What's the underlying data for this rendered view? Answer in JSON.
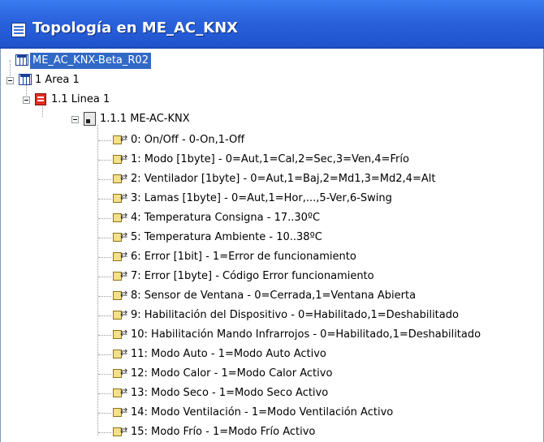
{
  "window": {
    "title": "Topología en ME_AC_KNX"
  },
  "tree": {
    "root": "ME_AC_KNX-Beta_R02",
    "area": "1 Area 1",
    "line": "1.1 Linea 1",
    "device": "1.1.1 ME-AC-KNX",
    "objects": [
      "0: On/Off - 0-On,1-Off",
      "1: Modo [1byte] - 0=Aut,1=Cal,2=Sec,3=Ven,4=Frío",
      "2: Ventilador [1byte] - 0=Aut,1=Baj,2=Md1,3=Md2,4=Alt",
      "3: Lamas [1byte] - 0=Aut,1=Hor,...,5-Ver,6-Swing",
      "4: Temperatura Consigna - 17..30ºC",
      "5: Temperatura Ambiente - 10..38ºC",
      "6: Error [1bit] - 1=Error de funcionamiento",
      "7: Error [1byte] - Código Error funcionamiento",
      "8: Sensor de Ventana - 0=Cerrada,1=Ventana Abierta",
      "9: Habilitación del Dispositivo - 0=Habilitado,1=Deshabilitado",
      "10: Habilitación Mando Infrarrojos - 0=Habilitado,1=Deshabilitado",
      "11: Modo Auto - 1=Modo Auto Activo",
      "12: Modo Calor - 1=Modo Calor Activo",
      "13: Modo Seco - 1=Modo Seco Activo",
      "14: Modo Ventilación - 1=Modo Ventilación Activo",
      "15: Modo Frío - 1=Modo Frío Activo"
    ]
  },
  "colors": {
    "titlebar": "#2a62dc",
    "selection": "#3169c6",
    "line_icon": "#e0301e",
    "object_icon": "#f5e08a"
  },
  "icons": {
    "root": "project-grid-icon",
    "area": "area-grid-icon",
    "line": "line-icon",
    "device": "device-icon",
    "object": "group-object-icon"
  }
}
